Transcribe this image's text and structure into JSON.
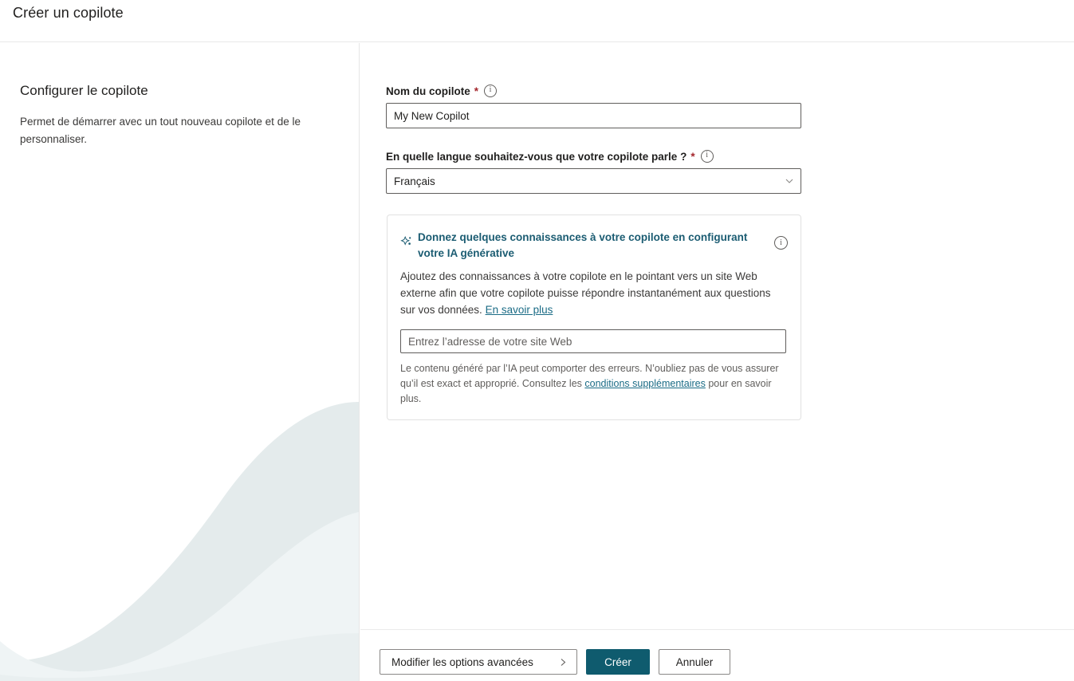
{
  "header": {
    "title": "Créer un copilote"
  },
  "left_pane": {
    "heading": "Configurer le copilote",
    "description": "Permet de démarrer avec un tout nouveau copilote et de le personnaliser."
  },
  "form": {
    "name_field": {
      "label": "Nom du copilote",
      "required_mark": "*",
      "value": "My New Copilot",
      "placeholder": "Nom du copilote",
      "info_icon": "info-icon"
    },
    "language_field": {
      "label": "En quelle langue souhaitez-vous que votre copilote parle ?",
      "required_mark": "*",
      "selected": "Français",
      "info_icon": "info-icon",
      "chevron_icon": "chevron-down-icon"
    }
  },
  "gen_ai_card": {
    "sparkle_icon": "sparkle-icon",
    "title": "Donnez quelques connaissances à votre copilote en configurant votre IA générative",
    "info_icon": "info-icon",
    "description_part1": "Ajoutez des connaissances à votre copilote en le pointant vers un site Web externe afin que votre copilote puisse répondre instantanément aux questions sur vos données. ",
    "description_link": "En savoir plus",
    "website_placeholder": "Entrez l’adresse de votre site Web",
    "website_value": "",
    "disclaimer_part1": "Le contenu généré par l’IA peut comporter des erreurs. N’oubliez pas de vous assurer qu’il est exact et approprié. Consultez les ",
    "disclaimer_link": "conditions supplémentaires",
    "disclaimer_part2": " pour en savoir plus."
  },
  "footer": {
    "advanced_options_label": "Modifier les options avancées",
    "advanced_options_chevron": "chevron-right-icon",
    "create_label": "Créer",
    "cancel_label": "Annuler"
  },
  "colors": {
    "primary_button": "#0f5b6e",
    "link": "#1b6c86",
    "card_title": "#1b5c72",
    "required_star": "#a4262c",
    "wave_light": "#f1f6f7",
    "wave_dark": "#e4ebec"
  }
}
